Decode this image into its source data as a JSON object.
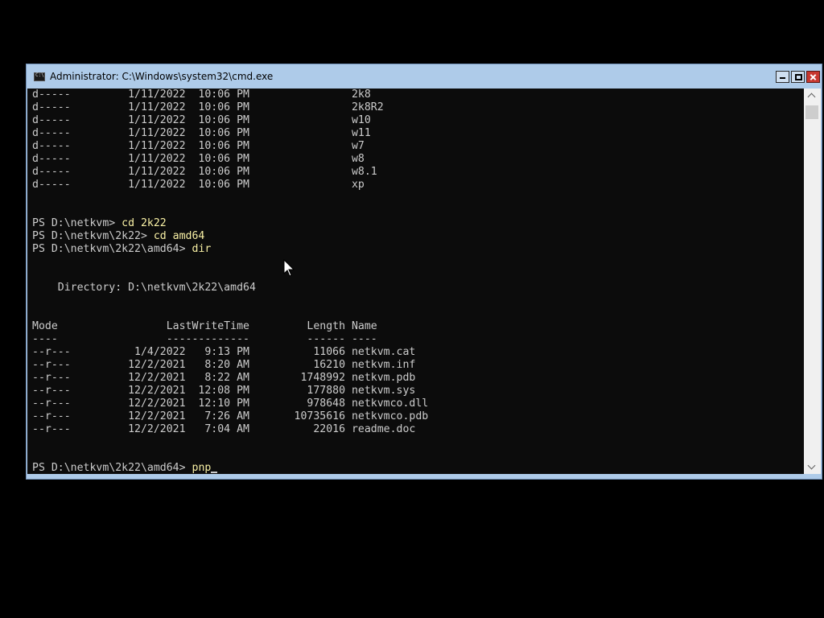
{
  "window": {
    "title": "Administrator: C:\\Windows\\system32\\cmd.exe",
    "icon": "cmd-icon"
  },
  "controls": {
    "minimize": "minimize-icon",
    "maximize": "maximize-icon",
    "close": "close-icon"
  },
  "terminal": {
    "lines": [
      {
        "text": "d-----         1/11/2022  10:06 PM                2k8"
      },
      {
        "text": "d-----         1/11/2022  10:06 PM                2k8R2"
      },
      {
        "text": "d-----         1/11/2022  10:06 PM                w10"
      },
      {
        "text": "d-----         1/11/2022  10:06 PM                w11"
      },
      {
        "text": "d-----         1/11/2022  10:06 PM                w7"
      },
      {
        "text": "d-----         1/11/2022  10:06 PM                w8"
      },
      {
        "text": "d-----         1/11/2022  10:06 PM                w8.1"
      },
      {
        "text": "d-----         1/11/2022  10:06 PM                xp"
      },
      {
        "text": ""
      },
      {
        "text": ""
      },
      {
        "prompt": "PS D:\\netkvm> ",
        "cmd": "cd 2k22"
      },
      {
        "prompt": "PS D:\\netkvm\\2k22> ",
        "cmd": "cd amd64"
      },
      {
        "prompt": "PS D:\\netkvm\\2k22\\amd64> ",
        "cmd": "dir"
      },
      {
        "text": ""
      },
      {
        "text": ""
      },
      {
        "text": "    Directory: D:\\netkvm\\2k22\\amd64"
      },
      {
        "text": ""
      },
      {
        "text": ""
      },
      {
        "text": "Mode                 LastWriteTime         Length Name"
      },
      {
        "text": "----                 -------------         ------ ----"
      },
      {
        "text": "--r---          1/4/2022   9:13 PM          11066 netkvm.cat"
      },
      {
        "text": "--r---         12/2/2021   8:20 AM          16210 netkvm.inf"
      },
      {
        "text": "--r---         12/2/2021   8:22 AM        1748992 netkvm.pdb"
      },
      {
        "text": "--r---         12/2/2021  12:08 PM         177880 netkvm.sys"
      },
      {
        "text": "--r---         12/2/2021  12:10 PM         978648 netkvmco.dll"
      },
      {
        "text": "--r---         12/2/2021   7:26 AM       10735616 netkvmco.pdb"
      },
      {
        "text": "--r---         12/2/2021   7:04 AM          22016 readme.doc"
      },
      {
        "text": ""
      },
      {
        "text": ""
      },
      {
        "prompt": "PS D:\\netkvm\\2k22\\amd64> ",
        "cmd": "pnp",
        "cursor": true
      }
    ]
  },
  "colors": {
    "console_bg": "#0c0c0c",
    "console_fg": "#cccccc",
    "command_fg": "#f9f1a5",
    "titlebar_bg": "#aecbe9",
    "close_bg": "#c7372f"
  }
}
